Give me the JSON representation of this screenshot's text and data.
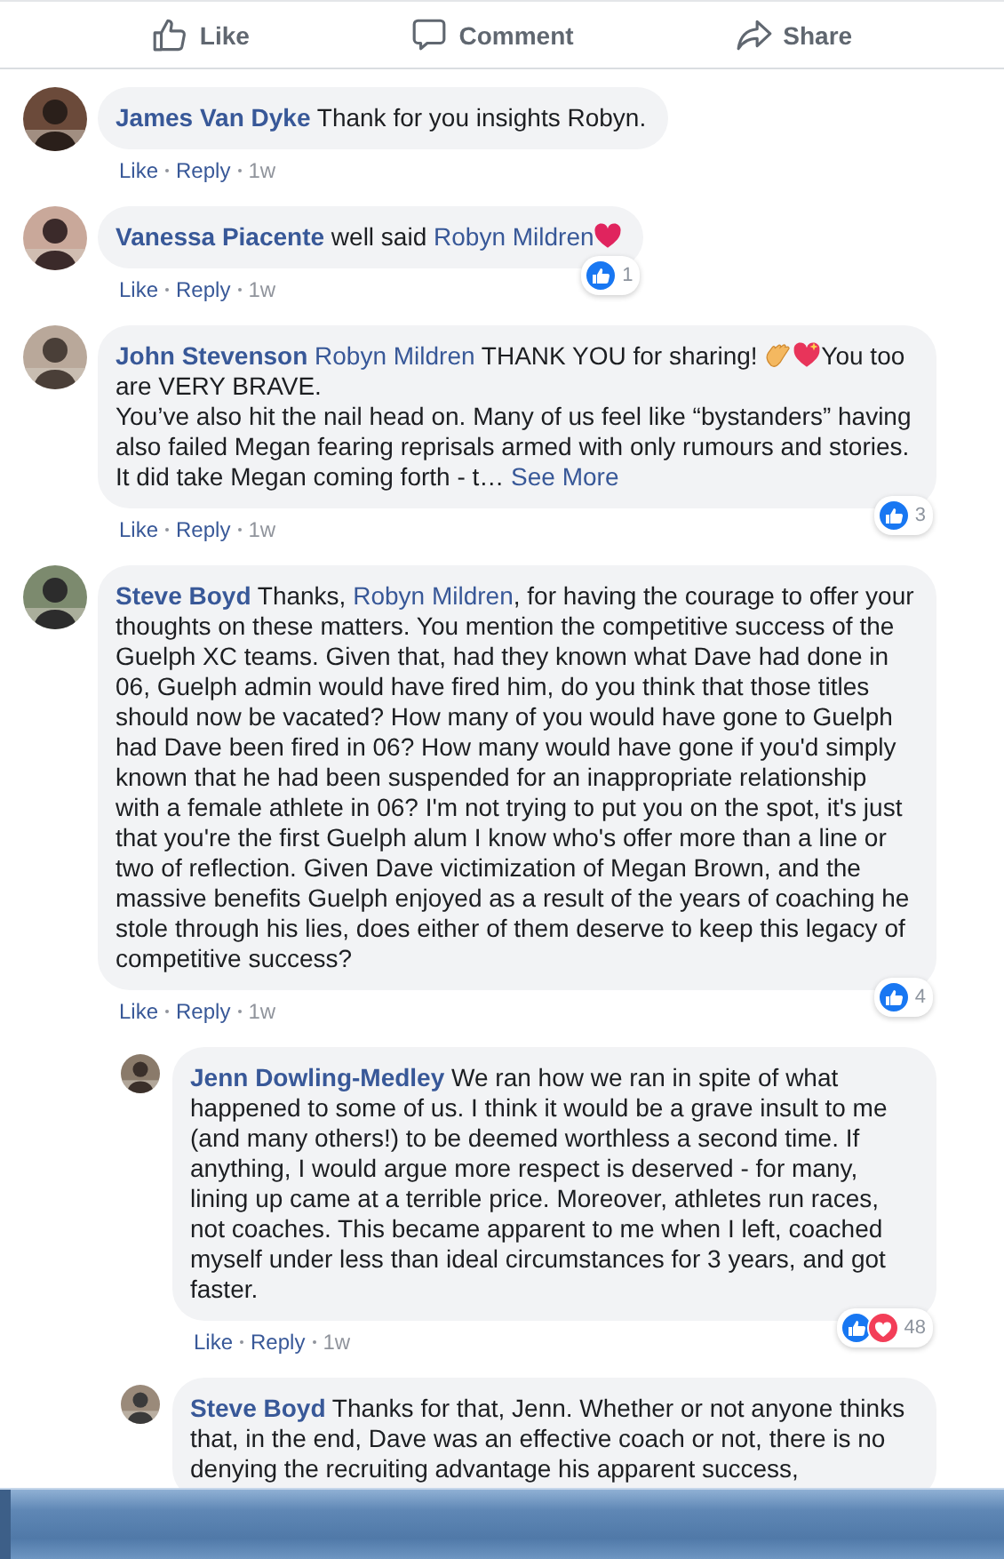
{
  "action_bar": [
    {
      "kind": "like",
      "label": "Like"
    },
    {
      "kind": "comment",
      "label": "Comment"
    },
    {
      "kind": "share",
      "label": "Share"
    }
  ],
  "comments": [
    {
      "kind": "comment",
      "author": "James Van Dyke",
      "segments": [
        {
          "kind": "text",
          "text": "Thank for you insights Robyn."
        }
      ],
      "actions": [
        {
          "kind": "link",
          "text": "Like"
        },
        {
          "kind": "link",
          "text": "Reply"
        },
        {
          "kind": "time",
          "text": "1w"
        }
      ]
    },
    {
      "kind": "comment",
      "author": "Vanessa Piacente",
      "segments": [
        {
          "kind": "text",
          "text": "well said "
        },
        {
          "kind": "mention",
          "text": "Robyn Mildren"
        },
        {
          "kind": "heart"
        }
      ],
      "actions": [
        {
          "kind": "link",
          "text": "Like"
        },
        {
          "kind": "link",
          "text": "Reply"
        },
        {
          "kind": "time",
          "text": "1w"
        }
      ],
      "reactions": {
        "types": [
          {
            "kind": "like"
          }
        ],
        "count": "1"
      }
    },
    {
      "kind": "comment",
      "author": "John Stevenson",
      "segments": [
        {
          "kind": "mention",
          "text": "Robyn Mildren"
        },
        {
          "kind": "text",
          "text": " THANK YOU for sharing! "
        },
        {
          "kind": "clap"
        },
        {
          "kind": "sparkle_heart"
        },
        {
          "kind": "text",
          "text": "You too are VERY BRAVE.\nYou’ve also hit the nail head on. Many of us feel like “bystanders” having also failed Megan fearing reprisals armed with only rumours and stories. It did take Megan coming forth - t… "
        },
        {
          "kind": "see_more",
          "text": "See More"
        }
      ],
      "actions": [
        {
          "kind": "link",
          "text": "Like"
        },
        {
          "kind": "link",
          "text": "Reply"
        },
        {
          "kind": "time",
          "text": "1w"
        }
      ],
      "reactions": {
        "types": [
          {
            "kind": "like"
          }
        ],
        "count": "3"
      }
    },
    {
      "kind": "comment",
      "author": "Steve Boyd",
      "segments": [
        {
          "kind": "text",
          "text": "Thanks, "
        },
        {
          "kind": "mention",
          "text": "Robyn Mildren"
        },
        {
          "kind": "text",
          "text": ", for having the courage to offer your thoughts on these matters. You mention the competitive success of the Guelph XC teams. Given that, had they known what Dave had done in 06, Guelph admin would have fired him, do you think that those titles should now be vacated? How many of you would have gone to Guelph had Dave been fired in 06? How many would have gone if you'd simply known that he had been suspended for an inappropriate relationship with a female athlete in 06? I'm not trying to put you on the spot, it's just that you're the first Guelph alum I know who's offer more than a line or two of reflection. Given Dave victimization of Megan Brown, and the massive benefits Guelph enjoyed as a result of the years of coaching he stole through his lies, does either of them deserve to keep this legacy of competitive success?"
        }
      ],
      "actions": [
        {
          "kind": "link",
          "text": "Like"
        },
        {
          "kind": "link",
          "text": "Reply"
        },
        {
          "kind": "time",
          "text": "1w"
        }
      ],
      "reactions": {
        "types": [
          {
            "kind": "like"
          }
        ],
        "count": "4"
      }
    },
    {
      "kind": "reply",
      "author": "Jenn Dowling-Medley",
      "segments": [
        {
          "kind": "text",
          "text": "We ran how we ran in spite of what happened to some of us. I think it would be a grave insult to me (and many others!) to be deemed worthless a second time. If anything, I would argue more respect is deserved - for many, lining up came at a terrible price. Moreover, athletes run races, not coaches. This became apparent to me when I left, coached myself under less than ideal circumstances for 3 years, and got faster."
        }
      ],
      "actions": [
        {
          "kind": "link",
          "text": "Like"
        },
        {
          "kind": "link",
          "text": "Reply"
        },
        {
          "kind": "time",
          "text": "1w"
        }
      ],
      "reactions": {
        "types": [
          {
            "kind": "like"
          },
          {
            "kind": "love"
          }
        ],
        "count": "48"
      }
    },
    {
      "kind": "reply",
      "author": "Steve Boyd",
      "segments": [
        {
          "kind": "text",
          "text": "Thanks for that, Jenn. Whether or not anyone thinks that, in the end, Dave was an effective coach or not, there is no denying the recruiting advantage his apparent success,"
        }
      ]
    }
  ]
}
